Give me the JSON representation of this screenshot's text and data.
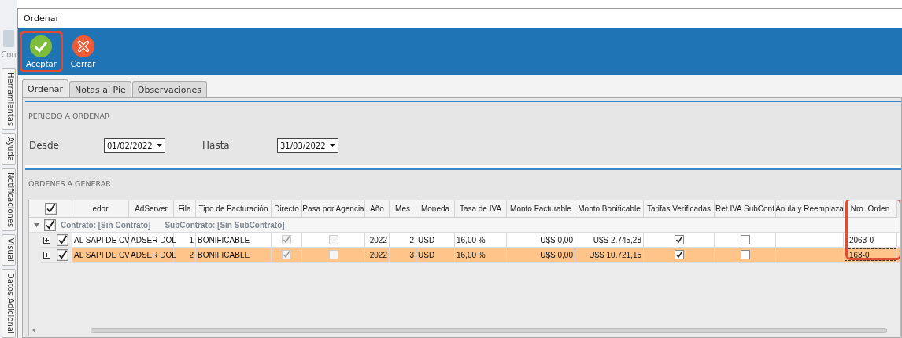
{
  "background_app": {
    "label": "Con",
    "side_tabs": [
      "Herramientas",
      "Ayuda",
      "Notificaciones",
      "Visual",
      "Datos Adicional"
    ]
  },
  "window": {
    "title": "Ordenar"
  },
  "toolbar": [
    {
      "kind": "accept",
      "label": "Aceptar",
      "highlighted": true
    },
    {
      "kind": "close",
      "label": "Cerrar",
      "highlighted": false
    }
  ],
  "tabs": [
    {
      "label": "Ordenar",
      "selected": true
    },
    {
      "label": "Notas al Pie",
      "selected": false
    },
    {
      "label": "Observaciones",
      "selected": false
    }
  ],
  "period": {
    "title": "PERIODO A ORDENAR",
    "fields": [
      {
        "label": "Desde",
        "value": "01/02/2022"
      },
      {
        "label": "Hasta",
        "value": "31/03/2022"
      }
    ]
  },
  "orders": {
    "title": "ÓRDENES A GENERAR",
    "header_checked": true,
    "columns": [
      {
        "label": "edor",
        "kind": "text",
        "highlighted": false
      },
      {
        "label": "AdServer",
        "kind": "text",
        "highlighted": false
      },
      {
        "label": "Fila",
        "kind": "number",
        "highlighted": false
      },
      {
        "label": "Tipo de Facturación",
        "kind": "text",
        "highlighted": false
      },
      {
        "label": "Directo",
        "kind": "check",
        "highlighted": false
      },
      {
        "label": "Pasa por Agencia",
        "kind": "check",
        "highlighted": false
      },
      {
        "label": "Año",
        "kind": "number",
        "highlighted": false
      },
      {
        "label": "Mes",
        "kind": "number",
        "highlighted": false
      },
      {
        "label": "Moneda",
        "kind": "text",
        "highlighted": false
      },
      {
        "label": "Tasa de IVA",
        "kind": "text",
        "highlighted": false
      },
      {
        "label": "Monto Facturable",
        "kind": "number",
        "highlighted": false
      },
      {
        "label": "Monto Bonificable",
        "kind": "number",
        "highlighted": false
      },
      {
        "label": "Tarifas Verificadas",
        "kind": "check",
        "highlighted": false
      },
      {
        "label": "Ret IVA SubCont",
        "kind": "check",
        "highlighted": false
      },
      {
        "label": "Anula y Reemplaza",
        "kind": "text",
        "highlighted": false
      },
      {
        "label": "Nro. Orden",
        "kind": "text",
        "highlighted": true
      }
    ],
    "group_row": {
      "expanded": true,
      "checked": true,
      "contract": "Contrato: [Sin Contrato]",
      "subcontract": "SubContrato: [Sin SubContrato]"
    },
    "rows": [
      {
        "selected": false,
        "checked": true,
        "expanded": false,
        "cells": [
          {
            "text": "AL SAPI DE CV"
          },
          {
            "text": "ADSER DOL"
          },
          {
            "text": "1"
          },
          {
            "text": "BONIFICABLE"
          },
          {
            "checked": true,
            "disabled": true
          },
          {
            "checked": false,
            "disabled": true
          },
          {
            "text": "2022"
          },
          {
            "text": "2"
          },
          {
            "text": "USD"
          },
          {
            "text": "16,00 %"
          },
          {
            "text": "U$S 0,00"
          },
          {
            "text": "U$S 2.745,28"
          },
          {
            "checked": true,
            "disabled": false
          },
          {
            "checked": false,
            "disabled": false
          },
          {
            "text": ""
          },
          {
            "text": "2063-0",
            "focused": false
          }
        ]
      },
      {
        "selected": true,
        "checked": true,
        "expanded": false,
        "cells": [
          {
            "text": "AL SAPI DE CV"
          },
          {
            "text": "ADSER DOL"
          },
          {
            "text": "2"
          },
          {
            "text": "BONIFICABLE"
          },
          {
            "checked": true,
            "disabled": true
          },
          {
            "checked": false,
            "disabled": true
          },
          {
            "text": "2022"
          },
          {
            "text": "3"
          },
          {
            "text": "USD"
          },
          {
            "text": "16,00 %"
          },
          {
            "text": "U$S 0,00"
          },
          {
            "text": "U$S 10.721,15"
          },
          {
            "checked": true,
            "disabled": false
          },
          {
            "checked": false,
            "disabled": false
          },
          {
            "text": ""
          },
          {
            "text": "163-0",
            "focused": true
          }
        ]
      }
    ]
  }
}
